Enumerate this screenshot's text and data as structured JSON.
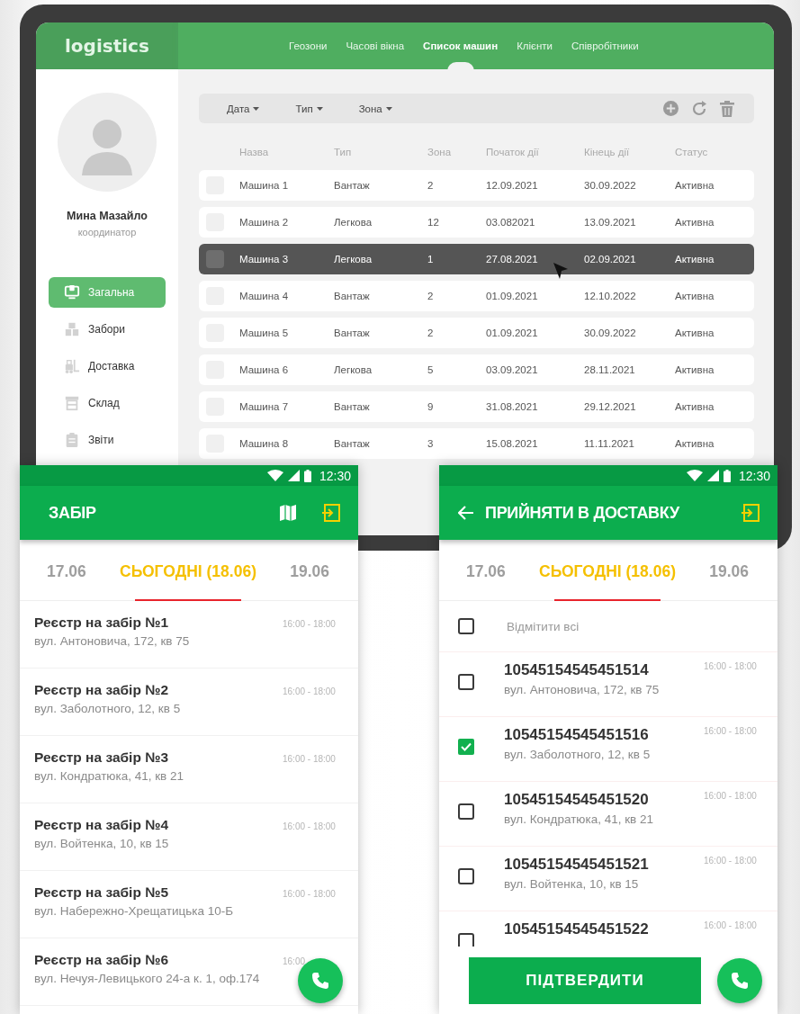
{
  "tablet": {
    "logo": "logistics",
    "nav": [
      {
        "label": "Геозони",
        "selected": false
      },
      {
        "label": "Часові вікна",
        "selected": false
      },
      {
        "label": "Список машин",
        "selected": true
      },
      {
        "label": "Клієнти",
        "selected": false
      },
      {
        "label": "Співробітники",
        "selected": false
      }
    ],
    "profile": {
      "name": "Мина Мазайло",
      "role": "координатор"
    },
    "sidebar": {
      "items": [
        {
          "label": "Загальна",
          "selected": true
        },
        {
          "label": "Забори",
          "selected": false
        },
        {
          "label": "Доставка",
          "selected": false
        },
        {
          "label": "Склад",
          "selected": false
        },
        {
          "label": "Звіти",
          "selected": false
        }
      ]
    },
    "toolbar": {
      "filters": [
        "Дата",
        "Тип",
        "Зона"
      ]
    },
    "table": {
      "columns": [
        "Назва",
        "Тип",
        "Зона",
        "Початок дії",
        "Кінець дії",
        "Статус"
      ],
      "rows": [
        {
          "cells": [
            "Машина 1",
            "Вантаж",
            "2",
            "12.09.2021",
            "30.09.2022",
            "Активна"
          ],
          "selected": false
        },
        {
          "cells": [
            "Машина 2",
            "Легкова",
            "12",
            "03.082021",
            "13.09.2021",
            "Активна"
          ],
          "selected": false
        },
        {
          "cells": [
            "Машина 3",
            "Легкова",
            "1",
            "27.08.2021",
            "02.09.2021",
            "Активна"
          ],
          "selected": true
        },
        {
          "cells": [
            "Машина 4",
            "Вантаж",
            "2",
            "01.09.2021",
            "12.10.2022",
            "Активна"
          ],
          "selected": false
        },
        {
          "cells": [
            "Машина 5",
            "Вантаж",
            "2",
            "01.09.2021",
            "30.09.2022",
            "Активна"
          ],
          "selected": false
        },
        {
          "cells": [
            "Машина 6",
            "Легкова",
            "5",
            "03.09.2021",
            "28.11.2021",
            "Активна"
          ],
          "selected": false
        },
        {
          "cells": [
            "Машина 7",
            "Вантаж",
            "9",
            "31.08.2021",
            "29.12.2021",
            "Активна"
          ],
          "selected": false
        },
        {
          "cells": [
            "Машина 8",
            "Вантаж",
            "3",
            "15.08.2021",
            "11.11.2021",
            "Активна"
          ],
          "selected": false
        }
      ]
    }
  },
  "phones": [
    {
      "kind": "pickup",
      "status_bar": {
        "time": "12:30"
      },
      "title": "ЗАБІР",
      "date_tabs": [
        {
          "label": "17.06",
          "selected": false
        },
        {
          "label": "СЬОГОДНІ (18.06)",
          "selected": true
        },
        {
          "label": "19.06",
          "selected": false
        }
      ],
      "items": [
        {
          "title": "Реєстр на забір №1",
          "address": "вул. Антоновича, 172, кв 75",
          "time": "16:00 - 18:00"
        },
        {
          "title": "Реєстр на забір №2",
          "address": "вул. Заболотного, 12, кв 5",
          "time": "16:00 - 18:00"
        },
        {
          "title": "Реєстр на забір №3",
          "address": "вул. Кондратюка, 41, кв 21",
          "time": "16:00 - 18:00"
        },
        {
          "title": "Реєстр на забір №4",
          "address": "вул. Войтенка, 10, кв 15",
          "time": "16:00 - 18:00"
        },
        {
          "title": "Реєстр на забір №5",
          "address": "вул. Набережно-Хрещатицька 10-Б",
          "time": "16:00 - 18:00"
        },
        {
          "title": "Реєстр на забір №6",
          "address": "вул. Нечуя-Левицького 24-а к. 1, оф.174",
          "time": "16:00 -"
        }
      ]
    },
    {
      "kind": "delivery",
      "status_bar": {
        "time": "12:30"
      },
      "title": "ПРИЙНЯТИ В ДОСТАВКУ",
      "date_tabs": [
        {
          "label": "17.06",
          "selected": false
        },
        {
          "label": "СЬОГОДНІ (18.06)",
          "selected": true
        },
        {
          "label": "19.06",
          "selected": false
        }
      ],
      "select_all": {
        "label": "Відмітити всі",
        "checked": false
      },
      "items": [
        {
          "title": "10545154545451514",
          "address": "вул. Антоновича, 172, кв 75",
          "time": "16:00 - 18:00",
          "checked": false
        },
        {
          "title": "10545154545451516",
          "address": "вул. Заболотного, 12, кв 5",
          "time": "16:00 - 18:00",
          "checked": true
        },
        {
          "title": "10545154545451520",
          "address": "вул. Кондратюка, 41, кв 21",
          "time": "16:00 - 18:00",
          "checked": false
        },
        {
          "title": "10545154545451521",
          "address": "вул. Войтенка, 10, кв 15",
          "time": "16:00 - 18:00",
          "checked": false
        },
        {
          "title": "10545154545451522",
          "time": "16:00 - 18:00",
          "checked": false
        }
      ],
      "confirm_button": "ПІДТВЕРДИТИ"
    }
  ]
}
